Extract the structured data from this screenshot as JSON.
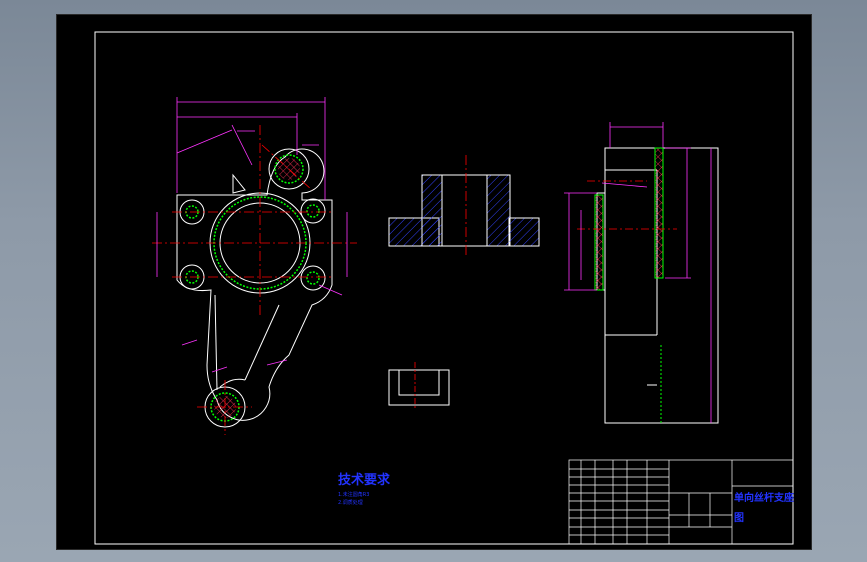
{
  "drawing": {
    "tech_title": "技术要求",
    "tech_notes": [
      "1.未注圆角R3",
      "2.调质处理"
    ],
    "part_name": "单向丝杆支座",
    "part_name_line2": "图"
  },
  "colors": {
    "background": "#000000",
    "frame": "#ffffff",
    "dimension": "#ff00ff",
    "centerline": "#ff0000",
    "hatch": "#0000ff",
    "thread": "#00ff00",
    "text": "#0000ff"
  }
}
